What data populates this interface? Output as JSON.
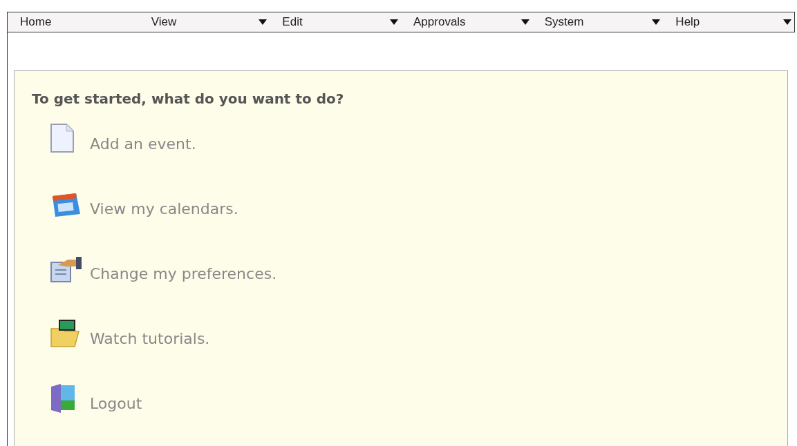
{
  "menu": [
    {
      "label": "Home",
      "dropdown": false
    },
    {
      "label": "View",
      "dropdown": true
    },
    {
      "label": "Edit",
      "dropdown": true
    },
    {
      "label": "Approvals",
      "dropdown": true
    },
    {
      "label": "System",
      "dropdown": true
    },
    {
      "label": "Help",
      "dropdown": true
    }
  ],
  "panel": {
    "heading": "To get started, what do you want to do?",
    "actions": [
      {
        "label": "Add an event.",
        "kind": "document"
      },
      {
        "label": "View my calendars.",
        "kind": "calendar"
      },
      {
        "label": "Change my preferences.",
        "kind": "preferences"
      },
      {
        "label": "Watch tutorials.",
        "kind": "tutorials"
      },
      {
        "label": "Logout",
        "kind": "logout"
      }
    ]
  }
}
